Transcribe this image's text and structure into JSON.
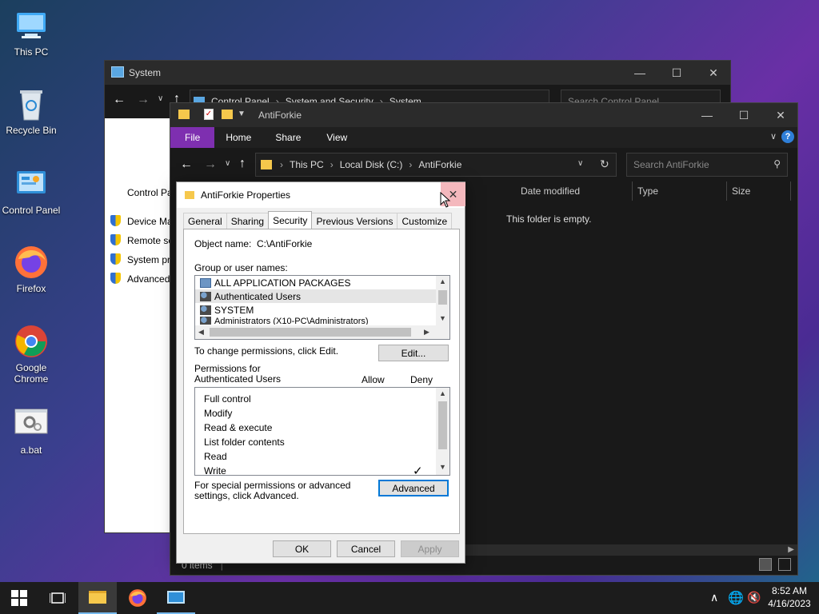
{
  "desktop": {
    "icons": [
      {
        "label": "This PC"
      },
      {
        "label": "Recycle Bin"
      },
      {
        "label": "Control Panel"
      },
      {
        "label": "Firefox"
      },
      {
        "label": "Google Chrome"
      },
      {
        "label": "a.bat"
      }
    ]
  },
  "system_window": {
    "title": "System",
    "breadcrumb": [
      "Control Panel",
      "System and Security",
      "System"
    ],
    "search_placeholder": "Search Control Panel",
    "sidebar": [
      "Control Pa",
      "Device Ma",
      "Remote se",
      "System pr",
      "Advanced"
    ]
  },
  "explorer": {
    "title": "AntiForkie",
    "ribbon_tabs": [
      "File",
      "Home",
      "Share",
      "View"
    ],
    "address": [
      "This PC",
      "Local Disk (C:)",
      "AntiForkie"
    ],
    "search_placeholder": "Search AntiForkie",
    "columns": [
      "Date modified",
      "Type",
      "Size"
    ],
    "empty_message": "This folder is empty.",
    "status": "0 items"
  },
  "properties": {
    "title": "AntiForkie Properties",
    "tabs": [
      "General",
      "Sharing",
      "Security",
      "Previous Versions",
      "Customize"
    ],
    "active_tab": "Security",
    "object_name_label": "Object name:",
    "object_name_value": "C:\\AntiForkie",
    "group_label": "Group or user names:",
    "groups": [
      "ALL APPLICATION PACKAGES",
      "Authenticated Users",
      "SYSTEM",
      "Administrators (X10-PC\\Administrators)"
    ],
    "selected_group_index": 1,
    "change_hint": "To change permissions, click Edit.",
    "edit_label": "Edit...",
    "permissions_label": "Permissions for Authenticated Users",
    "allow_label": "Allow",
    "deny_label": "Deny",
    "permissions": [
      {
        "name": "Full control",
        "allow": false,
        "deny": false
      },
      {
        "name": "Modify",
        "allow": false,
        "deny": false
      },
      {
        "name": "Read & execute",
        "allow": false,
        "deny": false
      },
      {
        "name": "List folder contents",
        "allow": false,
        "deny": false
      },
      {
        "name": "Read",
        "allow": false,
        "deny": false
      },
      {
        "name": "Write",
        "allow": false,
        "deny": true
      }
    ],
    "special_hint": "For special permissions or advanced settings, click Advanced.",
    "advanced_label": "Advanced",
    "ok_label": "OK",
    "cancel_label": "Cancel",
    "apply_label": "Apply"
  },
  "taskbar": {
    "time": "8:52 AM",
    "date": "4/16/2023"
  },
  "colors": {
    "accent": "#0078d7",
    "file_tab": "#7e2fb0",
    "close_hover": "#e81123"
  }
}
